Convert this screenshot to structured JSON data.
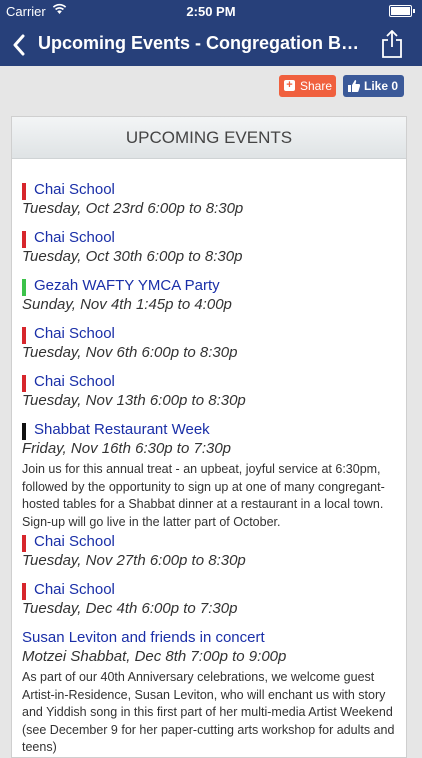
{
  "status_bar": {
    "carrier": "Carrier",
    "time": "2:50 PM"
  },
  "nav": {
    "title": "Upcoming Events - Congregation Bnai..."
  },
  "social": {
    "share_label": "Share",
    "like_label": "Like",
    "like_count": "0"
  },
  "panel": {
    "header": "UPCOMING EVENTS"
  },
  "colors": {
    "red": "#d7262c",
    "green": "#3cc24a",
    "black": "#111111",
    "navy": "#27407a"
  },
  "events": [
    {
      "title": "Chai School",
      "date": "Tuesday, Oct 23rd 6:00p to 8:30p",
      "color": "red"
    },
    {
      "title": "Chai School",
      "date": "Tuesday, Oct 30th 6:00p to 8:30p",
      "color": "red"
    },
    {
      "title": "Gezah WAFTY YMCA Party",
      "date": "Sunday, Nov 4th 1:45p to 4:00p",
      "color": "green"
    },
    {
      "title": "Chai School",
      "date": "Tuesday, Nov 6th 6:00p to 8:30p",
      "color": "red"
    },
    {
      "title": "Chai School",
      "date": "Tuesday, Nov 13th 6:00p to 8:30p",
      "color": "red"
    },
    {
      "title": "Shabbat Restaurant Week",
      "date": "Friday, Nov 16th 6:30p to 7:30p",
      "color": "black",
      "description": "Join us for this annual treat - an upbeat, joyful service at 6:30pm, followed by the opportunity to sign up at one of many congregant-hosted tables for a Shabbat dinner at a restaurant in a local town. Sign-up will go live in the latter part of October."
    },
    {
      "title": "Chai School",
      "date": "Tuesday, Nov 27th 6:00p to 8:30p",
      "color": "red"
    },
    {
      "title": "Chai School",
      "date": "Tuesday, Dec 4th 6:00p to 7:30p",
      "color": "red"
    },
    {
      "title": "Susan Leviton and friends in concert",
      "date": "Motzei Shabbat, Dec 8th 7:00p to 9:00p",
      "color": "none",
      "description": "As part of our 40th Anniversary celebrations, we welcome guest Artist-in-Residence, Susan Leviton, who will enchant us with story and Yiddish song in this first part of her multi-media Artist Weekend (see December 9 for her paper-cutting arts workshop for adults and teens)"
    }
  ]
}
